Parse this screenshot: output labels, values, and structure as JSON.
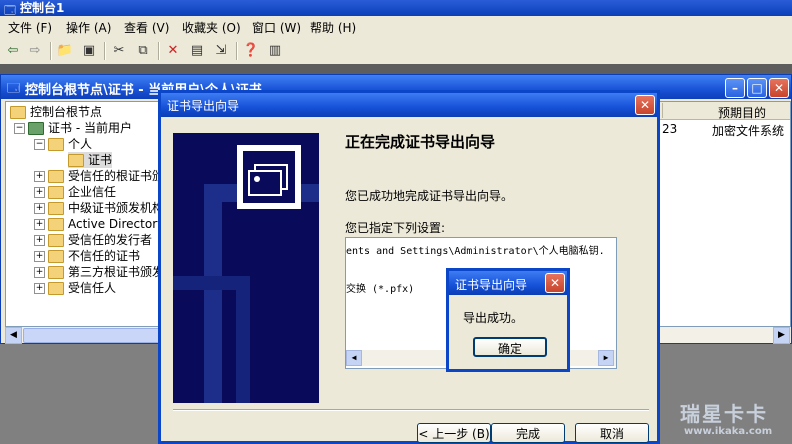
{
  "app": {
    "title": "控制台1"
  },
  "menu": [
    "文件 (F)",
    "操作 (A)",
    "查看 (V)",
    "收藏夹 (O)",
    "窗口 (W)",
    "帮助 (H)"
  ],
  "mdi": {
    "title": "控制台根节点\\证书 - 当前用户\\个人\\证书",
    "tree": [
      "控制台根节点",
      "证书 - 当前用户",
      "个人",
      "证书",
      "受信任的根证书颁发机构",
      "企业信任",
      "中级证书颁发机构",
      "Active Directory 用户对象",
      "受信任的发行者",
      "不信任的证书",
      "第三方根证书颁发机构",
      "受信任人"
    ],
    "list": {
      "column_header": "预期目的",
      "partial_cell": "23",
      "cell_purpose": "加密文件系统"
    }
  },
  "wizard": {
    "title": "证书导出向导",
    "heading": "正在完成证书导出向导",
    "line1": "您已成功地完成证书导出向导。",
    "line2": "您已指定下列设置:",
    "settings": [
      "ents and Settings\\Administrator\\个人电脑私钥.",
      "交换 (*.pfx)"
    ],
    "back_label": "< 上一步 (B)",
    "finish_label": "完成",
    "cancel_label": "取消"
  },
  "msgbox": {
    "title": "证书导出向导",
    "message": "导出成功。",
    "ok_label": "确定"
  },
  "watermark": {
    "brand": "瑞星卡卡",
    "url": "www.ikaka.com"
  },
  "colors": {
    "titlebar": "#0b45c8",
    "wizard_side": "#0a0a5a",
    "close": "#c8442b"
  }
}
